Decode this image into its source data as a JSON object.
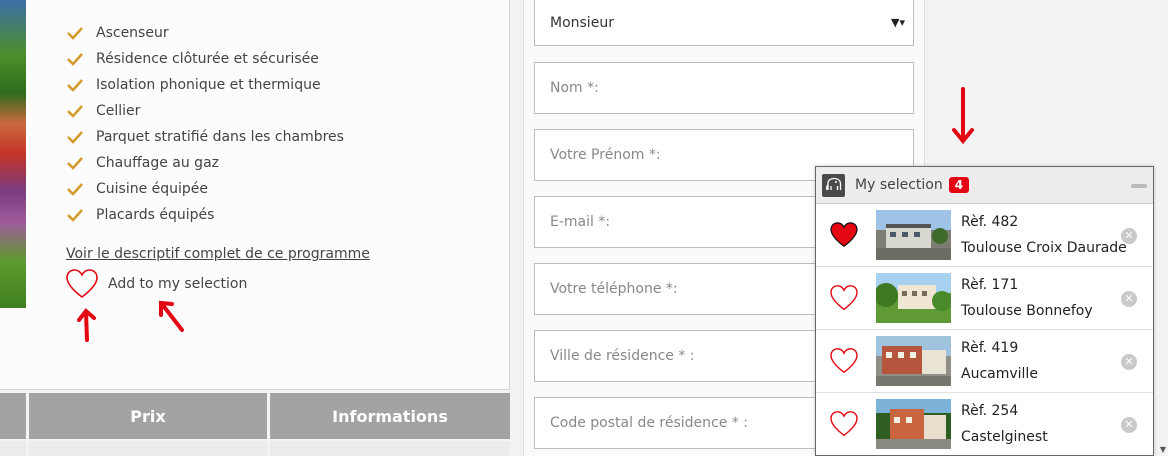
{
  "features": [
    "Ascenseur",
    "Résidence clôturée et sécurisée",
    "Isolation phonique et thermique",
    "Cellier",
    "Parquet stratifié dans les chambres",
    "Chauffage au gaz",
    "Cuisine équipée",
    "Placards équipés"
  ],
  "descr_link": "Voir le descriptif complet de ce programme",
  "add_selection": "Add to my selection",
  "table": {
    "headers": [
      "",
      "Prix",
      "Informations"
    ]
  },
  "form": {
    "civility": "Monsieur",
    "fields": [
      "Nom *:",
      "Votre Prénom *:",
      "E-mail *:",
      "Votre téléphone *:",
      "Ville de résidence * :",
      "Code postal de résidence * :"
    ]
  },
  "selection": {
    "title": "My selection",
    "count": "4",
    "items": [
      {
        "ref": "Rèf. 482",
        "city": "Toulouse Croix Daurade",
        "favorited": true
      },
      {
        "ref": "Rèf. 171",
        "city": "Toulouse Bonnefoy",
        "favorited": false
      },
      {
        "ref": "Rèf. 419",
        "city": "Aucamville",
        "favorited": false
      },
      {
        "ref": "Rèf. 254",
        "city": "Castelginest",
        "favorited": false
      }
    ]
  },
  "colors": {
    "accent": "#e30613",
    "check": "#d39a2c",
    "header_bg": "#a3a3a3"
  },
  "icons": {
    "check": "check-icon",
    "heart": "heart-icon",
    "close": "close-icon",
    "elephant": "elephant-icon"
  }
}
